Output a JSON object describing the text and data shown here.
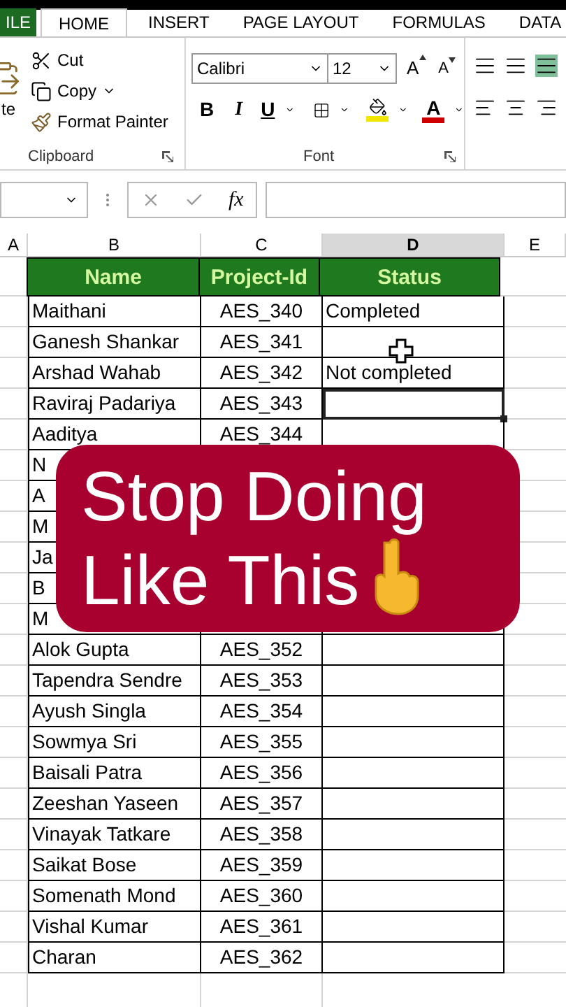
{
  "tabs": [
    {
      "label": "ILE",
      "kind": "file",
      "selected": false
    },
    {
      "label": "HOME",
      "kind": "tab",
      "selected": true
    },
    {
      "label": "INSERT",
      "kind": "tab",
      "selected": false
    },
    {
      "label": "PAGE LAYOUT",
      "kind": "tab",
      "selected": false
    },
    {
      "label": "FORMULAS",
      "kind": "tab",
      "selected": false
    },
    {
      "label": "DATA",
      "kind": "tab",
      "selected": false
    }
  ],
  "clipboard": {
    "paste_label": "te",
    "title": "Clipboard",
    "items": [
      {
        "label": "Cut",
        "kind": "cut",
        "has_menu": false
      },
      {
        "label": "Copy",
        "kind": "copy",
        "has_menu": true
      },
      {
        "label": "Format Painter",
        "kind": "painter",
        "has_menu": false
      }
    ]
  },
  "font": {
    "title": "Font",
    "name": "Calibri",
    "size": "12",
    "grow": "A",
    "shrink": "A",
    "bold": "B",
    "italic": "I",
    "underline": "U",
    "color_letter": "A"
  },
  "formula_bar": {
    "fx": "fx"
  },
  "columns": [
    {
      "label": "A",
      "selected": false
    },
    {
      "label": "B",
      "selected": false
    },
    {
      "label": "C",
      "selected": false
    },
    {
      "label": "D",
      "selected": true
    },
    {
      "label": "E",
      "selected": false
    }
  ],
  "table": {
    "headers": [
      "Name",
      "Project-Id",
      "Status"
    ],
    "rows": [
      {
        "name": "Maithani",
        "id": "AES_340",
        "status": "Completed",
        "selected": false
      },
      {
        "name": "Ganesh Shankar",
        "id": "AES_341",
        "selected": false,
        "cursor": true
      },
      {
        "name": "Arshad Wahab",
        "id": "AES_342",
        "status": "Not completed",
        "selected": false
      },
      {
        "name": "Raviraj Padariya",
        "id": "AES_343",
        "selected": true
      },
      {
        "name": "Aaditya",
        "id": "AES_344",
        "selected": false
      },
      {
        "name": "N"
      },
      {
        "name": "A"
      },
      {
        "name": "M"
      },
      {
        "name": "Ja"
      },
      {
        "name": "B"
      },
      {
        "name": "M"
      },
      {
        "name": "Alok Gupta",
        "id": "AES_352",
        "selected": false
      },
      {
        "name": "Tapendra Sendre",
        "id": "AES_353",
        "selected": false
      },
      {
        "name": "Ayush Singla",
        "id": "AES_354",
        "selected": false
      },
      {
        "name": "Sowmya Sri",
        "id": "AES_355",
        "selected": false
      },
      {
        "name": "Baisali Patra",
        "id": "AES_356",
        "selected": false
      },
      {
        "name": "Zeeshan Yaseen",
        "id": "AES_357",
        "selected": false
      },
      {
        "name": "Vinayak Tatkare",
        "id": "AES_358",
        "selected": false
      },
      {
        "name": "Saikat Bose",
        "id": "AES_359",
        "selected": false
      },
      {
        "name": "Somenath Mond",
        "id": "AES_360",
        "selected": false
      },
      {
        "name": "Vishal Kumar",
        "id": "AES_361",
        "selected": false
      },
      {
        "name": "Charan",
        "id": "AES_362",
        "selected": false
      }
    ]
  },
  "banner": {
    "lines": [
      "Stop Doing",
      "Like This"
    ]
  }
}
